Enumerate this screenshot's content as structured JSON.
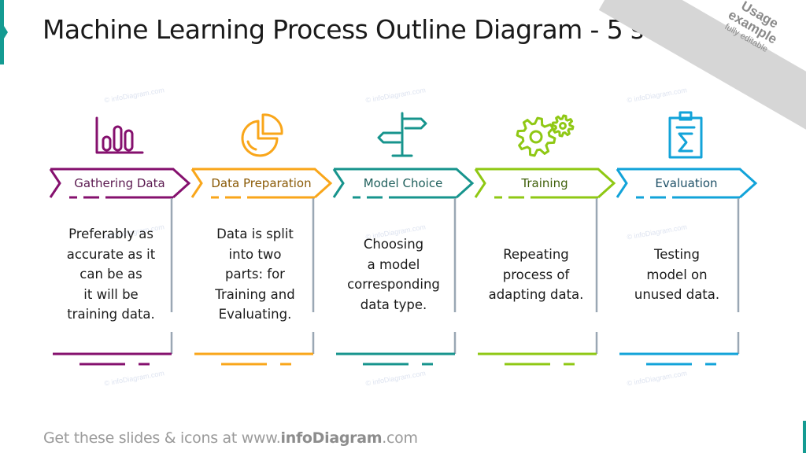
{
  "title": "Machine Learning Process Outline Diagram - 5 steps",
  "ribbon": {
    "line1": "Usage",
    "line2": "example",
    "line3": "fully editable"
  },
  "watermark": "© infoDiagram.com",
  "footer": {
    "prefix": "Get these slides & icons at www.",
    "brand": "infoDiagram",
    "suffix": ".com"
  },
  "colors": {
    "accent": "#149b92",
    "divider": "#9aa7b4"
  },
  "steps": [
    {
      "label": "Gathering Data",
      "icon": "bar-chart-icon",
      "color": "#85106e",
      "text_color": "#5b1a50",
      "lines": [
        "Preferably as",
        "accurate as it",
        "can be as",
        "it will be",
        "training data."
      ]
    },
    {
      "label": "Data Preparation",
      "icon": "pie-chart-icon",
      "color": "#f9a61a",
      "text_color": "#8a5a06",
      "lines": [
        "Data is split",
        "into two",
        "parts: for",
        "Training and",
        "Evaluating."
      ]
    },
    {
      "label": "Model Choice",
      "icon": "signpost-icon",
      "color": "#17948d",
      "text_color": "#1f5f5c",
      "lines": [
        "Choosing",
        "a model",
        "corresponding",
        "data type."
      ]
    },
    {
      "label": "Training",
      "icon": "gears-icon",
      "color": "#8fc814",
      "text_color": "#3f5f0a",
      "lines": [
        "Repeating",
        "process of",
        "adapting data."
      ]
    },
    {
      "label": "Evaluation",
      "icon": "clipboard-sigma-icon",
      "color": "#12a3d9",
      "text_color": "#1d4f66",
      "lines": [
        "Testing",
        "model on",
        "unused data."
      ]
    }
  ]
}
